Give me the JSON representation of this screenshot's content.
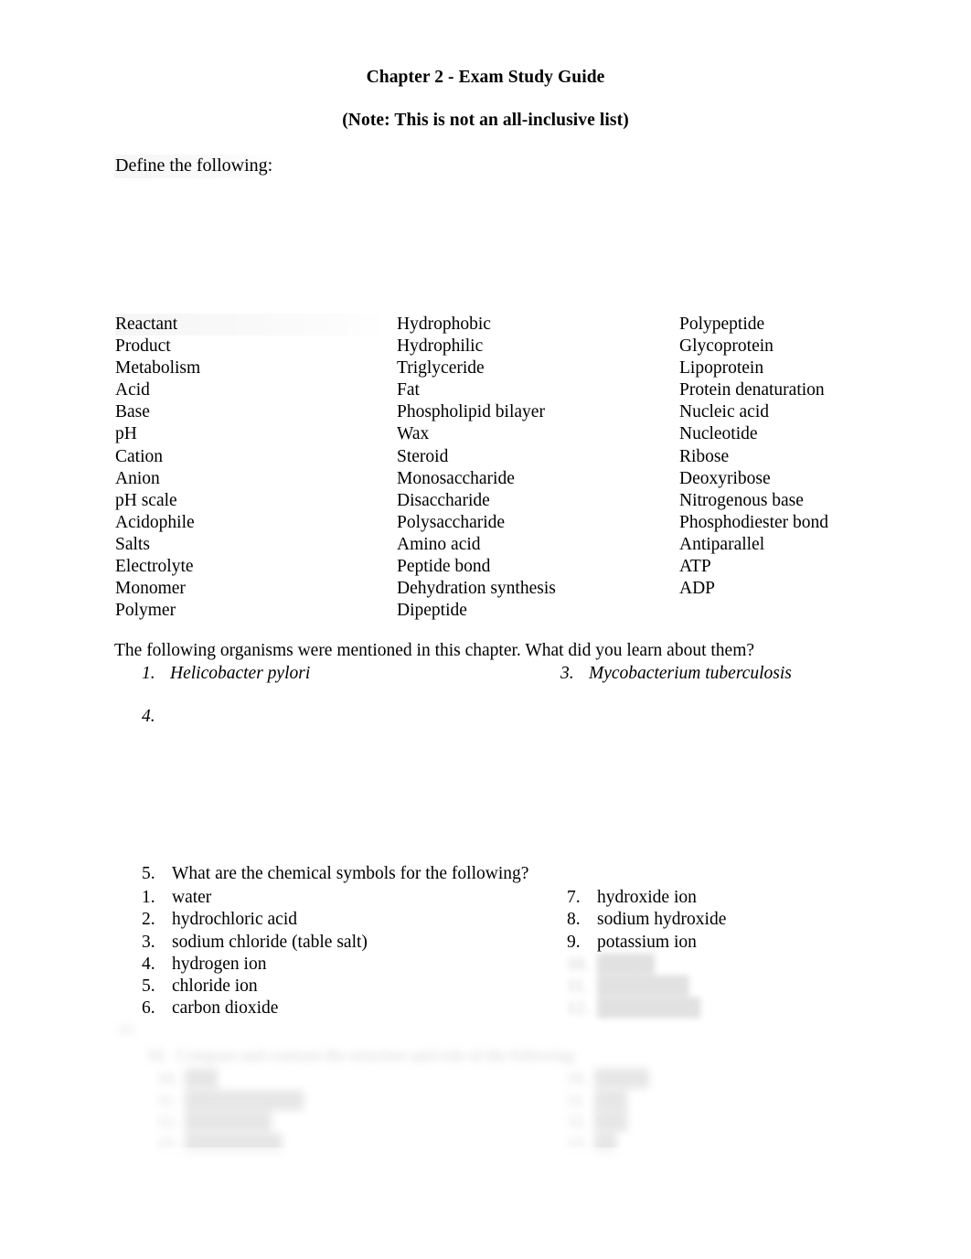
{
  "document": {
    "title": "Chapter 2 - Exam Study Guide",
    "subtitle": "(Note: This is not an all-inclusive list)",
    "define_prompt": "Define the following:"
  },
  "terms": {
    "column_1": [
      "Reactant",
      "Product",
      "Metabolism",
      "Acid",
      "Base",
      "pH",
      "Cation",
      "Anion",
      "pH scale",
      "Acidophile",
      "Salts",
      "Electrolyte",
      "Monomer",
      "Polymer"
    ],
    "column_2": [
      "Hydrophobic",
      "Hydrophilic",
      "Triglyceride",
      "Fat",
      "Phospholipid bilayer",
      "Wax",
      "Steroid",
      "Monosaccharide",
      "Disaccharide",
      "Polysaccharide",
      "Amino acid",
      "Peptide bond",
      "Dehydration synthesis",
      "Dipeptide"
    ],
    "column_3": [
      "Polypeptide",
      "Glycoprotein",
      "Lipoprotein",
      "Protein denaturation",
      "Nucleic acid",
      "Nucleotide",
      "Ribose",
      "Deoxyribose",
      "Nitrogenous base",
      "Phosphodiester bond",
      "Antiparallel",
      "ATP",
      "ADP"
    ]
  },
  "organisms": {
    "prompt": "The following organisms were mentioned in this chapter. What did you learn about them?",
    "item_1_marker": "1.",
    "item_1_label": "Helicobacter pylori",
    "item_3_marker": "3.",
    "item_3_label": "Mycobacterium tuberculosis",
    "item_4_marker": "4.",
    "item_4_label": ""
  },
  "chemical_symbols": {
    "question_marker": "5.",
    "question": "What are the chemical symbols for the following?",
    "left": [
      {
        "marker": "1.",
        "label": "water"
      },
      {
        "marker": "2.",
        "label": "hydrochloric acid"
      },
      {
        "marker": "3.",
        "label": "sodium chloride (table salt)"
      },
      {
        "marker": "4.",
        "label": "hydrogen ion"
      },
      {
        "marker": "5.",
        "label": "chloride ion"
      },
      {
        "marker": "6.",
        "label": "carbon dioxide"
      }
    ],
    "right": [
      {
        "marker": "7.",
        "label": "hydroxide ion"
      },
      {
        "marker": "8.",
        "label": "sodium hydroxide"
      },
      {
        "marker": "9.",
        "label": "potassium ion"
      }
    ]
  },
  "obscured": {
    "note": "Lower portion of the page is blurred and illegible in the screenshot.",
    "right_extra": [
      {
        "marker": "",
        "label": ""
      },
      {
        "marker": "",
        "label": ""
      },
      {
        "marker": "",
        "label": ""
      }
    ],
    "question_marker": "",
    "question": "",
    "sub_left": [
      {
        "marker": "",
        "label": ""
      },
      {
        "marker": "",
        "label": ""
      },
      {
        "marker": "",
        "label": ""
      },
      {
        "marker": "",
        "label": ""
      }
    ],
    "sub_right": [
      {
        "marker": "",
        "label": ""
      },
      {
        "marker": "",
        "label": ""
      },
      {
        "marker": "",
        "label": ""
      },
      {
        "marker": "",
        "label": ""
      }
    ]
  }
}
